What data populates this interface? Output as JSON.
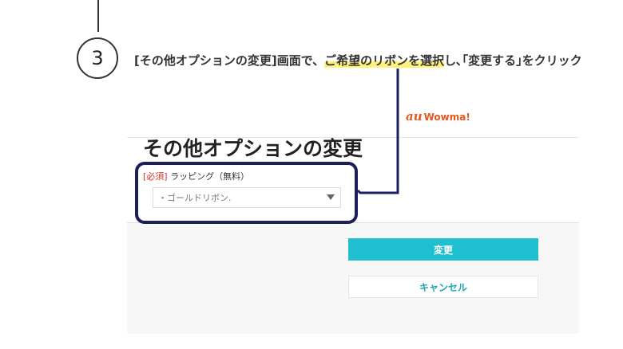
{
  "step": {
    "number": "3"
  },
  "instruction": {
    "part1": "[その他オプションの変更]画面で、",
    "highlight": "ご希望のリボンを選択",
    "part2": "し､｢変更する｣をクリック"
  },
  "brand": {
    "mark": "au",
    "name": "Wowma!"
  },
  "screenshot": {
    "title": "その他オプションの変更",
    "field": {
      "required": "[必須]",
      "label": "ラッピング（無料）",
      "selected_value": "・ゴールドリボン."
    },
    "buttons": {
      "change": "変更",
      "cancel": "キャンセル"
    }
  },
  "colors": {
    "highlight": "#fff27a",
    "callout": "#1e1e5c",
    "accent": "#1fbfcf",
    "brand": "#e8561c"
  }
}
